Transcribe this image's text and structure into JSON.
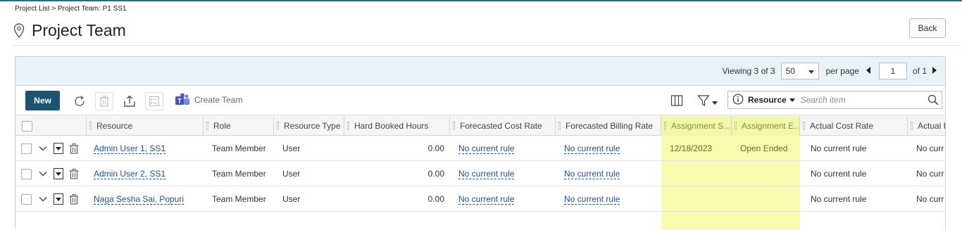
{
  "breadcrumb": {
    "project_list": "Project List",
    "separator": ">",
    "current": "Project Team: P1 SS1"
  },
  "header": {
    "title": "Project Team",
    "pin_icon": "location-pin-icon",
    "back_label": "Back"
  },
  "pager": {
    "viewing_prefix": "Viewing",
    "viewing_current": "3",
    "viewing_of": "of",
    "viewing_total": "3",
    "per_page_value": "50",
    "per_page_label": "per page",
    "page_value": "1",
    "of_pages": "of 1"
  },
  "toolbar": {
    "new_label": "New",
    "create_team_label": "Create Team",
    "search_field": "Resource",
    "search_placeholder": "Search item"
  },
  "columns": [
    "Resource",
    "Role",
    "Resource Type",
    "Hard Booked Hours",
    "Forecasted Cost Rate",
    "Forecasted Billing Rate",
    "Assignment S...",
    "Assignment E...",
    "Actual Cost Rate",
    "Actual I"
  ],
  "rows": [
    {
      "resource": "Admin User 1, SS1",
      "role": "Team Member",
      "type": "User",
      "hours": "0.00",
      "fcr": "No current rule",
      "fbr": "No current rule",
      "start": "12/18/2023",
      "end": "Open Ended",
      "acr": "No current rule",
      "abr": "No curr"
    },
    {
      "resource": "Admin User 2, SS1",
      "role": "Team Member",
      "type": "User",
      "hours": "0.00",
      "fcr": "No current rule",
      "fbr": "No current rule",
      "start": "",
      "end": "",
      "acr": "No current rule",
      "abr": "No curr"
    },
    {
      "resource": "Naga Sesha Sai, Popuri",
      "role": "Team Member",
      "type": "User",
      "hours": "0.00",
      "fcr": "No current rule",
      "fbr": "No current rule",
      "start": "",
      "end": "",
      "acr": "No current rule",
      "abr": "No curr"
    }
  ],
  "colors": {
    "accent": "#1d5370",
    "highlight": "#f7f9a0",
    "link": "#1f4f8f",
    "pager_bg": "#e9f2f8"
  }
}
